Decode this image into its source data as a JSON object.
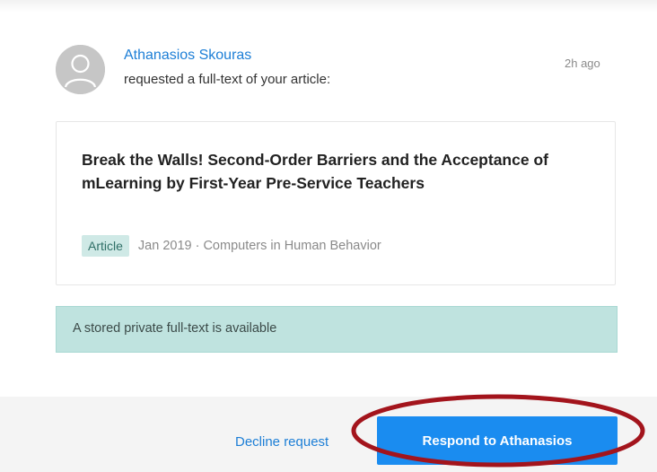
{
  "request": {
    "requester_name": "Athanasios Skouras",
    "action_text": "requested a full-text of your article:",
    "timestamp": "2h ago"
  },
  "article": {
    "title": "Break the Walls! Second-Order Barriers and the Acceptance of mLearning by First-Year Pre-Service Teachers",
    "type": "Article",
    "info": "Jan 2019 · Computers in Human Behavior"
  },
  "banner": {
    "text": "A stored private full-text is available"
  },
  "actions": {
    "decline_label": "Decline request",
    "respond_label": "Respond to Athanasios"
  },
  "colors": {
    "link_blue": "#1c7ed6",
    "button_blue": "#1a8cf0",
    "banner_teal": "#bfe3df",
    "badge_teal": "#cfe9e6",
    "highlight_red": "#a3141c"
  },
  "icons": {
    "avatar": "default-user-avatar-icon"
  }
}
